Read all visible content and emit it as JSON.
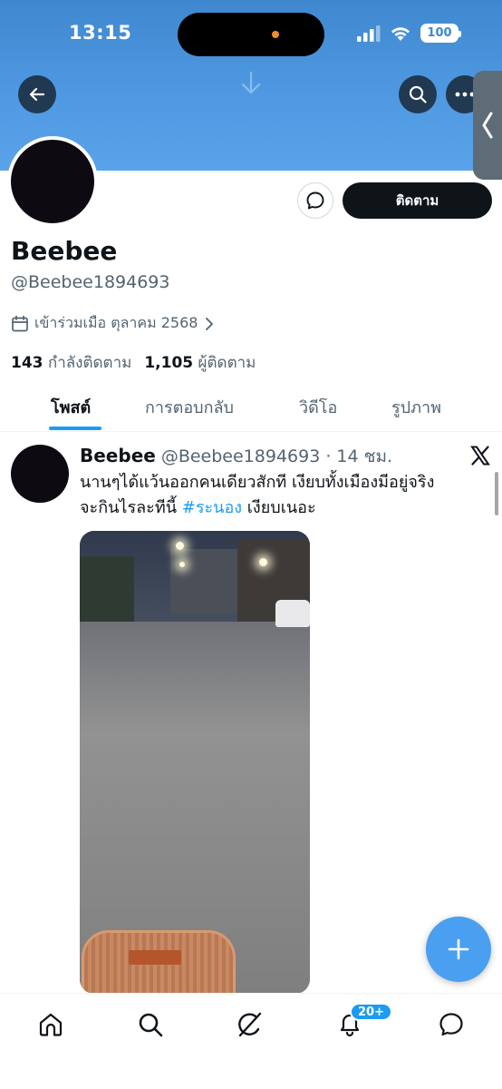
{
  "status_bar": {
    "time": "13:15",
    "battery": "100"
  },
  "profile": {
    "display_name": "Beebee",
    "handle": "@Beebee1894693",
    "joined": "เข้าร่วมเมือ ตุลาคม 2568",
    "following_count": "143",
    "following_label": "กำลังติดตาม",
    "followers_count": "1,105",
    "followers_label": "ผู้ติดตาม",
    "follow_button": "ติดตาม"
  },
  "tabs": [
    {
      "label": "โพสต์",
      "active": true
    },
    {
      "label": "การตอบกลับ",
      "active": false
    },
    {
      "label": "วิดีโอ",
      "active": false
    },
    {
      "label": "รูปภาพ",
      "active": false
    }
  ],
  "post": {
    "author": "Beebee",
    "handle": "@Beebee1894693",
    "separator": "·",
    "time": "14 ชม.",
    "text_line1": "นานๆได้แว้นออกคนเดียวสักที เงียบทั้งเมืองมีอยู่จริง",
    "text_line2_pre": "จะกินไรละทีนี้ ",
    "hashtag": "#ระนอง",
    "text_line2_post": " เงียบเนอะ"
  },
  "bottom_nav": {
    "notification_badge": "20+"
  },
  "colors": {
    "accent": "#1d9bf0",
    "banner": "#4f99e2",
    "text": "#0f1419",
    "muted": "#536471"
  }
}
